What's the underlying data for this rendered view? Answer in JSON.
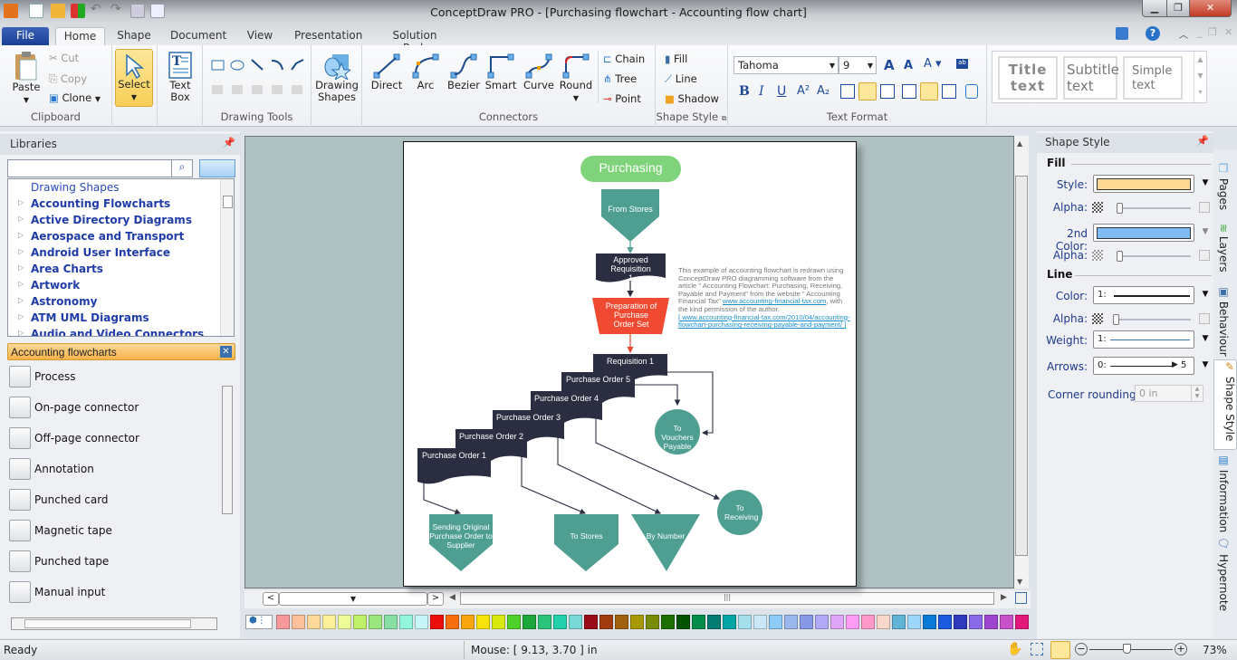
{
  "window": {
    "title": "ConceptDraw PRO - [Purchasing flowchart - Accounting flow chart]",
    "controls": {
      "minimize": "minimize",
      "restore": "restore",
      "close": "close"
    }
  },
  "quick_access": [
    "app-logo-icon",
    "new-document-icon",
    "open-folder-icon",
    "solution-icon",
    "undo-icon",
    "redo-icon",
    "save-icon",
    "print-preview-icon"
  ],
  "menu_tabs": [
    {
      "label": "File",
      "active": false
    },
    {
      "label": "Home",
      "active": true
    },
    {
      "label": "Shape",
      "active": false
    },
    {
      "label": "Document",
      "active": false
    },
    {
      "label": "View",
      "active": false
    },
    {
      "label": "Presentation",
      "active": false
    },
    {
      "label": "Solution Park",
      "active": false
    }
  ],
  "ribbon": {
    "clipboard": {
      "label": "Clipboard",
      "paste": "Paste",
      "cut": "Cut",
      "copy": "Copy",
      "clone": "Clone"
    },
    "select": {
      "label": "Select"
    },
    "textbox": {
      "label": "Text Box"
    },
    "drawing_tools": {
      "label": "Drawing Tools"
    },
    "drawing_shapes": {
      "label": "Drawing Shapes"
    },
    "connectors": {
      "label": "Connectors",
      "items": [
        "Direct",
        "Arc",
        "Bezier",
        "Smart",
        "Curve",
        "Round"
      ],
      "chain": "Chain",
      "tree": "Tree",
      "point": "Point"
    },
    "shape_style": {
      "label": "Shape Style",
      "fill": "Fill",
      "line": "Line",
      "shadow": "Shadow"
    },
    "text_format": {
      "label": "Text Format",
      "font": "Tahoma",
      "size": "9",
      "bold": "B",
      "italic": "I",
      "underline": "U"
    },
    "styles": {
      "title": "Title text",
      "subtitle": "Subtitle text",
      "simple": "Simple text"
    }
  },
  "libraries": {
    "title": "Libraries",
    "search_placeholder": "",
    "tree": [
      "Drawing Shapes",
      "Accounting Flowcharts",
      "Active Directory Diagrams",
      "Aerospace and Transport",
      "Android User Interface",
      "Area Charts",
      "Artwork",
      "Astronomy",
      "ATM UML Diagrams",
      "Audio and Video Connectors"
    ],
    "open_library": "Accounting flowcharts",
    "shapes": [
      "Process",
      "On-page connector",
      "Off-page connector",
      "Annotation",
      "Punched card",
      "Magnetic tape",
      "Punched tape",
      "Manual input"
    ]
  },
  "diagram": {
    "title": "Purchasing",
    "from_stores": "From Stores",
    "approved_req": "Approved Requisition 1",
    "prep_po": "Preparation of Purchase Order Set",
    "req1": "Requisition 1",
    "po5": "Purchase Order 5",
    "po4": "Purchase Order 4",
    "po3": "Purchase Order 3",
    "po2": "Purchase Order 2",
    "po1": "Purchase Order 1",
    "vouchers": "To Vouchers Payable",
    "receiving": "To Receiving",
    "sending": "Sending Original Purchase Order to Supplier",
    "to_stores": "To Stores",
    "by_number": "By Number",
    "note_text": "This example of accounting flowchart is redrawn using ConceptDraw PRO diagramming software from the article \" Accounting Flowchart: Purchasing, Receiving, Payable and Payment\" from the website \" Accounting Financial Tax\"",
    "note_link1": "www.accounting-financial-tax.com",
    "note_mid": ", with the kind permission of the author.",
    "note_link2": "[ www.accounting-financial-tax.com/2010/04/accounting-flowchart-purchasing-receiving-payable-and-payment/ ]",
    "colors": {
      "teal": "#4e9e92",
      "dark": "#2a2e40",
      "red": "#f04a32",
      "green": "#7fd37a"
    }
  },
  "shape_style_panel": {
    "title": "Shape Style",
    "fill_section": "Fill",
    "style_label": "Style:",
    "style_color": "#ffd993",
    "alpha_label": "Alpha:",
    "second_color_label": "2nd Color:",
    "second_color": "#7fbcf5",
    "line_section": "Line",
    "color_label": "Color:",
    "color_value": "1:",
    "weight_label": "Weight:",
    "weight_value": "1:",
    "arrows_label": "Arrows:",
    "arrows_start": "0:",
    "arrows_end": "5",
    "corner_label": "Corner rounding:",
    "corner_value": "0 in"
  },
  "side_tabs": [
    "Pages",
    "Layers",
    "Behaviour",
    "Shape Style",
    "Information",
    "Hypernote"
  ],
  "palette": [
    "#f7999a",
    "#fcc19a",
    "#fdd99a",
    "#fdf09a",
    "#eefb99",
    "#c0ef6a",
    "#9ce67f",
    "#88dfa4",
    "#92f5dc",
    "#c8f5f7",
    "#ee0d0d",
    "#f86e0d",
    "#f9a50d",
    "#f7e20b",
    "#d7ea0b",
    "#4fd12a",
    "#1da63a",
    "#2bc47a",
    "#22d1ab",
    "#79d9d9",
    "#990c17",
    "#a03c0f",
    "#a0620e",
    "#a89903",
    "#798c05",
    "#1d6e02",
    "#035200",
    "#038c4a",
    "#037b71",
    "#03a5a5",
    "#a6dfec",
    "#c9e9f8",
    "#8ecbf6",
    "#99b7ea",
    "#8799e7",
    "#b2aaf7",
    "#dea6f7",
    "#ff9cf4",
    "#ff99c9",
    "#f9d7cb",
    "#60b5d6",
    "#9fd7fb",
    "#0a7ad7",
    "#1b59df",
    "#2f39bb",
    "#8b6ae9",
    "#9d45cf",
    "#c850c8",
    "#e1197a"
  ],
  "status": {
    "ready": "Ready",
    "mouse": "Mouse: [ 9.13, 3.70 ] in",
    "zoom": "73%",
    "zoom_fraction": 0.45
  }
}
